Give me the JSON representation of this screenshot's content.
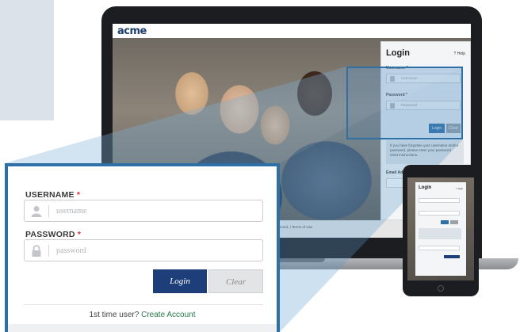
{
  "laptop": {
    "logo": "acme",
    "copyright": "...ers, LLC. All rights reserved. | Terms of Use",
    "mini_login": {
      "title": "Login",
      "help": "? Help",
      "username_label": "Username *",
      "username_placeholder": "Username",
      "password_label": "Password *",
      "password_placeholder": "Password",
      "login_button": "Login",
      "clear_button": "Clear",
      "note": "If you have forgotten your username and/or password, please enter your password reset instructions.",
      "email_label": "Email Address"
    }
  },
  "tablet": {
    "title": "Login",
    "help": "? Help"
  },
  "login_card": {
    "username_label": "USERNAME",
    "username_required": "*",
    "username_placeholder": "username",
    "password_label": "PASSWORD",
    "password_required": "*",
    "password_placeholder": "password",
    "login_button": "Login",
    "clear_button": "Clear",
    "first_time_text": "1st time user?",
    "create_account_link": "Create Account"
  },
  "colors": {
    "accent_blue": "#2e6fa5",
    "button_navy": "#1d3e78",
    "required_red": "#d0312d",
    "link_green": "#2a7a4a"
  }
}
